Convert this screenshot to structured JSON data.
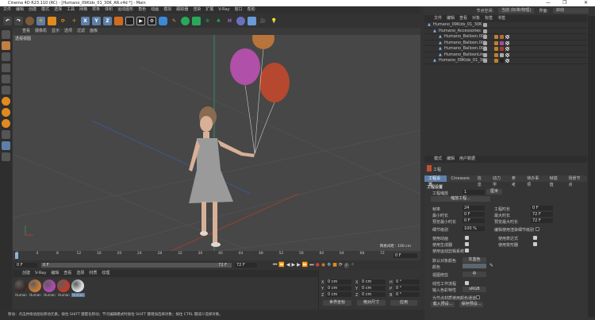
{
  "window": {
    "title": "Cinema 4D R23.110 (RC) - [Humano_09Kids_01_30K_AR.c4d *] - Main",
    "min": "—",
    "max": "❐",
    "close": "✕"
  },
  "menu": [
    "文件",
    "编辑",
    "创建",
    "模式",
    "选择",
    "工具",
    "网格",
    "样条",
    "体积",
    "运动图形",
    "角色",
    "动画",
    "模拟",
    "跟踪器",
    "渲染",
    "扩展",
    "V-Ray",
    "窗口",
    "帮助"
  ],
  "toolbar": {
    "x": "X",
    "y": "Y",
    "z": "Z"
  },
  "viewport": {
    "menu": [
      "查看",
      "摄像机",
      "显示",
      "选项",
      "过滤",
      "面板"
    ],
    "title": "透视视图",
    "grid_spacing": "网格间距 : 100 cm"
  },
  "top_right": {
    "node_space_label": "节点空间:",
    "node_space_value": "当前 (标准/物理)",
    "layout_label": "界面:",
    "layout_value": "启动"
  },
  "object_manager": {
    "menu": [
      "文件",
      "编辑",
      "查看",
      "对象",
      "标签",
      "书签"
    ],
    "objects": [
      {
        "name": "Humano_09Kids_01_30K",
        "indent": 0
      },
      {
        "name": "Humano_Accessories",
        "indent": 1
      },
      {
        "name": "Humano_Balloon.003",
        "indent": 2,
        "color": "#b86a2e"
      },
      {
        "name": "Humano_Balloon.001",
        "indent": 2,
        "color": "#a64aa6"
      },
      {
        "name": "Humano_Balloon.002",
        "indent": 2,
        "color": "#b03a2a"
      },
      {
        "name": "Humano_BalloonLine",
        "indent": 2,
        "color": "#aaaaaa"
      },
      {
        "name": "Humano_09Kids_01_30K",
        "indent": 1,
        "color": "#222222"
      }
    ]
  },
  "attributes": {
    "menu": [
      "模式",
      "编辑",
      "用户数据"
    ],
    "object": "工程",
    "tabs": [
      "工程设置",
      "Cineware",
      "信息",
      "动力学",
      "参考",
      "待办事项",
      "帧插值",
      "场景节点"
    ],
    "section": "工程设置",
    "project_scale_label": "工程缩放",
    "project_scale": "1",
    "project_scale_unit": "厘米",
    "scale_project_btn": "缩放工程...",
    "fps_label": "帧率",
    "fps": "24",
    "project_time_label": "工程时长",
    "project_time": "0 F",
    "min_time_label": "最小时长",
    "min_time": "0 F",
    "max_time_label": "最大时长",
    "max_time": "72 F",
    "preview_min_label": "预览最小时长",
    "preview_min": "0 F",
    "preview_max_label": "预览最大时长",
    "preview_max": "72 F",
    "lod_label": "细节级别",
    "lod": "100 %",
    "render_lod_label": "编辑使用渲染细节级别",
    "use_animation": "使用动画",
    "use_expressions": "使用表达式",
    "use_generators": "使用生成器",
    "use_deformers": "使用变形器",
    "use_motion": "使用运动剪辑系统",
    "default_color_label": "默认对象颜色",
    "default_color": "灰蓝色",
    "color_label": "颜色",
    "clipping_label": "视图修剪",
    "clipping": "中",
    "linear_label": "线性工作流程",
    "input_color_label": "输入色彩特性",
    "input_color": "sRGB",
    "node_color_label": "为节点材质使用颜色通道",
    "load_preset": "载入预设...",
    "save_preset": "保存预设..."
  },
  "timeline": {
    "ticks": [
      "0",
      "4",
      "8",
      "12",
      "16",
      "20",
      "24",
      "28",
      "32",
      "36",
      "40",
      "44",
      "48",
      "52",
      "56",
      "60",
      "64",
      "68",
      "72"
    ],
    "current": "0 F",
    "start": "0 F",
    "range_start": "0 F",
    "range_end": "72 F",
    "end": "72 F"
  },
  "materials": {
    "menu": [
      "创建",
      "V-Ray",
      "编辑",
      "查看",
      "选择",
      "材质",
      "纹理"
    ],
    "items": [
      {
        "label": "Human",
        "color": "#3a2a2a"
      },
      {
        "label": "Human",
        "color": "#c67a35"
      },
      {
        "label": "Human",
        "color": "#b04ab0"
      },
      {
        "label": "Human",
        "color": "#c03a2a"
      },
      {
        "label": "Human",
        "color": "#dddddd"
      }
    ]
  },
  "coords": {
    "x1": "0 cm",
    "y1": "0 cm",
    "z1": "0 cm",
    "x2": "0 cm",
    "y2": "0 cm",
    "z2": "0 cm",
    "h": "0 °",
    "p": "0 °",
    "b": "0 °",
    "mode": "世界坐标",
    "size": "绝对尺寸",
    "apply": "应用"
  },
  "status": "移动：点击并拖动鼠标移动元素。按住 SHIFT 键量化移动；节点编辑模式时按住 SHIFT 键增加选择对象；按住 CTRL 键减少选择对象。"
}
